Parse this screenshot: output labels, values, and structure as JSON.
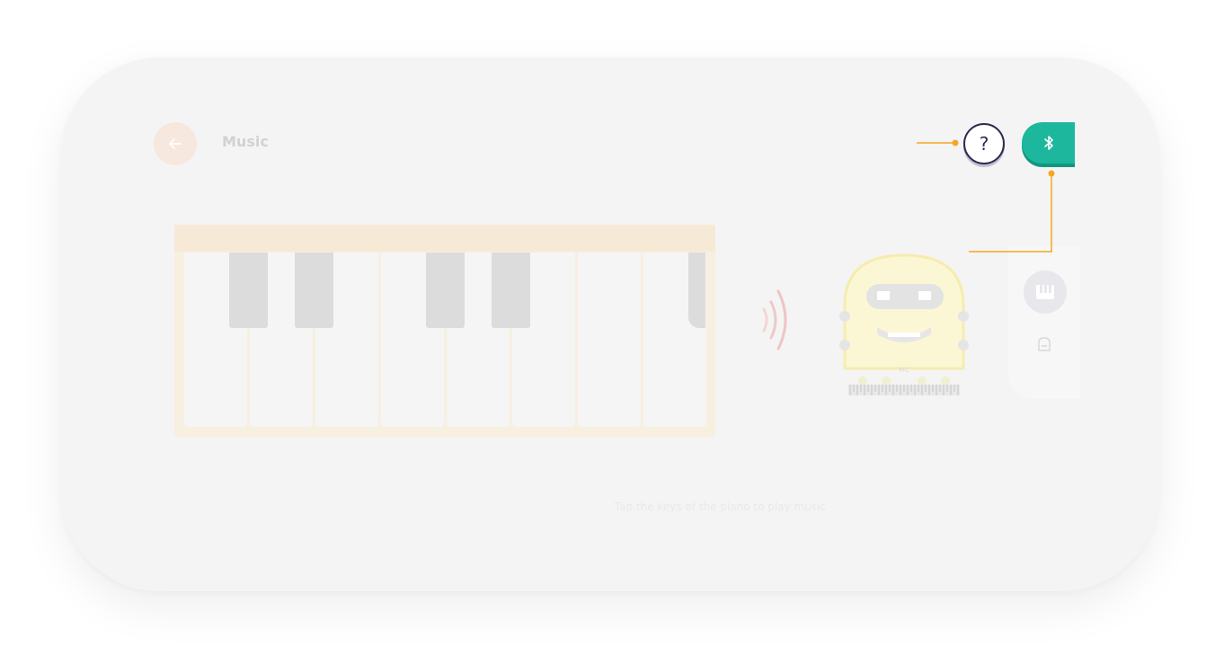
{
  "header": {
    "title": "Music",
    "back_icon": "arrow-left-icon"
  },
  "piano": {
    "white_key_count": 8,
    "black_key_count": 5
  },
  "robot": {
    "label": "PIC"
  },
  "side_panel": {
    "items": [
      {
        "icon": "piano-icon",
        "selected": true
      },
      {
        "icon": "tile-icon",
        "selected": false
      }
    ]
  },
  "instruction": "Tap the keys of the piano to play music",
  "toolbar": {
    "help_label": "?",
    "bluetooth_icon": "bluetooth-icon"
  },
  "colors": {
    "accent": "#1cb79d",
    "callout": "#f5a623",
    "help_border": "#2f2a52",
    "back_button": "#f7e8df"
  }
}
